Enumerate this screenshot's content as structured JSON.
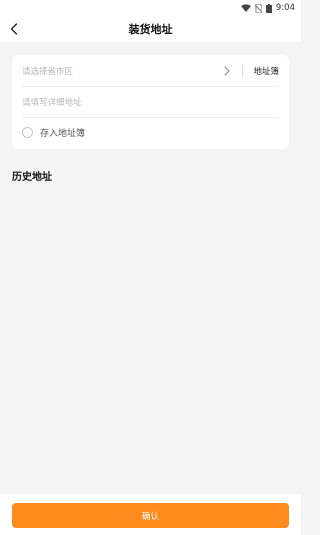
{
  "status_bar": {
    "time": "9:04",
    "icons": [
      "wifi-icon",
      "no-sim-icon",
      "battery-icon"
    ]
  },
  "nav": {
    "title": "装货地址",
    "back_icon": "chevron-left-icon"
  },
  "address_form": {
    "region_placeholder": "请选择省市区",
    "address_book_label": "地址簿",
    "detail_placeholder": "请填写详细地址",
    "save_to_book_label": "存入地址簿"
  },
  "history": {
    "title": "历史地址",
    "items": []
  },
  "footer": {
    "confirm_label": "确认"
  },
  "colors": {
    "accent": "#ff8a1e",
    "background": "#f4f4f4",
    "card": "#ffffff",
    "placeholder": "#b8b8b8"
  }
}
